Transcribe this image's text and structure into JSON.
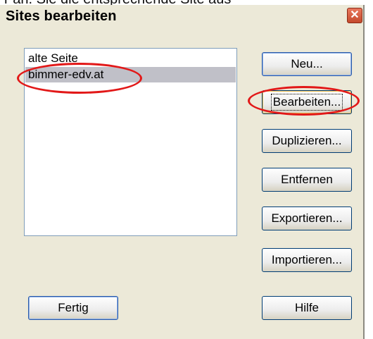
{
  "page_top_text": "r an. Sie die entsprechende Site aus",
  "dialog": {
    "title": "Sites bearbeiten",
    "close_glyph": "✕"
  },
  "sites": {
    "items": [
      {
        "label": "alte Seite",
        "selected": false
      },
      {
        "label": "bimmer-edv.at",
        "selected": true
      }
    ]
  },
  "buttons": {
    "new": "Neu...",
    "edit": "Bearbeiten...",
    "duplicate": "Duplizieren...",
    "remove": "Entfernen",
    "export": "Exportieren...",
    "import": "Importieren...",
    "done": "Fertig",
    "help": "Hilfe"
  },
  "colors": {
    "annotation": "#e21818",
    "selection": "#c0c0c8",
    "dialog_bg": "#ece9d8"
  }
}
